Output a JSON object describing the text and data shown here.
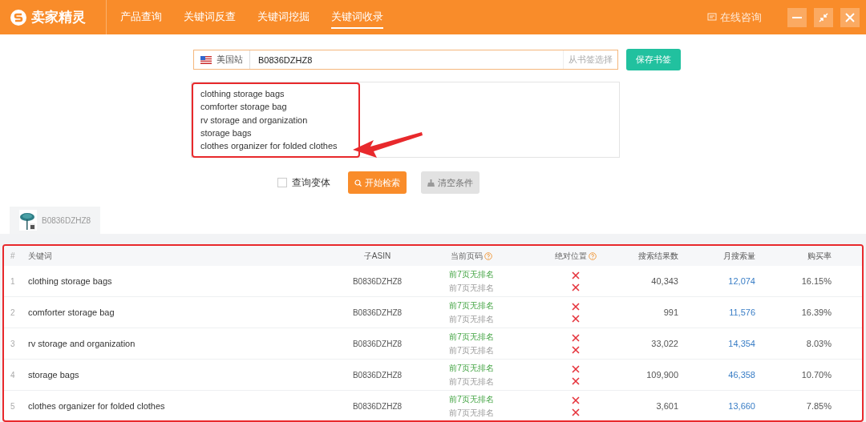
{
  "header": {
    "brand": "卖家精灵",
    "nav": [
      {
        "label": "产品查询",
        "selected": false
      },
      {
        "label": "关键词反查",
        "selected": false
      },
      {
        "label": "关键词挖掘",
        "selected": false
      },
      {
        "label": "关键词收录",
        "selected": true
      }
    ],
    "consult": "在线咨询"
  },
  "search": {
    "site": "美国站",
    "value": "B0836DZHZ8",
    "bookmark_link": "从书签选择",
    "save_button": "保存书签",
    "keywords": [
      "clothing storage bags",
      "comforter storage bag",
      "rv storage and organization",
      "storage bags",
      "clothes organizer for folded clothes"
    ],
    "variant": {
      "label": "查询变体",
      "checked": false
    },
    "start_button": "开始检索",
    "clear_button": {
      "label": "清空条件",
      "disabled": true
    }
  },
  "result_tabs": [
    {
      "label": "B0836DZHZ8",
      "selected": true,
      "kind": "picture"
    }
  ],
  "table": {
    "columns": [
      "#",
      "关键词",
      "子ASIN",
      "当前页码",
      "绝对位置",
      "搜索结果数",
      "月搜索量",
      "购买率"
    ],
    "rows": [
      {
        "index": "1",
        "keyword": "clothing storage bags",
        "asin": "B0836DZHZ8",
        "page_top": "前7页无排名",
        "page_bottom": "前7页无排名",
        "results": "40,343",
        "monthly": "12,074",
        "rate": "16.15%"
      },
      {
        "index": "2",
        "keyword": "comforter storage bag",
        "asin": "B0836DZHZ8",
        "page_top": "前7页无排名",
        "page_bottom": "前7页无排名",
        "results": "991",
        "monthly": "11,576",
        "rate": "16.39%"
      },
      {
        "index": "3",
        "keyword": "rv storage and organization",
        "asin": "B0836DZHZ8",
        "page_top": "前7页无排名",
        "page_bottom": "前7页无排名",
        "results": "33,022",
        "monthly": "14,354",
        "rate": "8.03%"
      },
      {
        "index": "4",
        "keyword": "storage bags",
        "asin": "B0836DZHZ8",
        "page_top": "前7页无排名",
        "page_bottom": "前7页无排名",
        "results": "109,900",
        "monthly": "46,358",
        "rate": "10.70%"
      },
      {
        "index": "5",
        "keyword": "clothes organizer for folded clothes",
        "asin": "B0836DZHZ8",
        "page_top": "前7页无排名",
        "page_bottom": "前7页无排名",
        "results": "3,601",
        "monthly": "13,660",
        "rate": "7.85%"
      }
    ]
  },
  "annotations": {
    "keywords_box": true,
    "arrow": true,
    "table_box": true
  }
}
